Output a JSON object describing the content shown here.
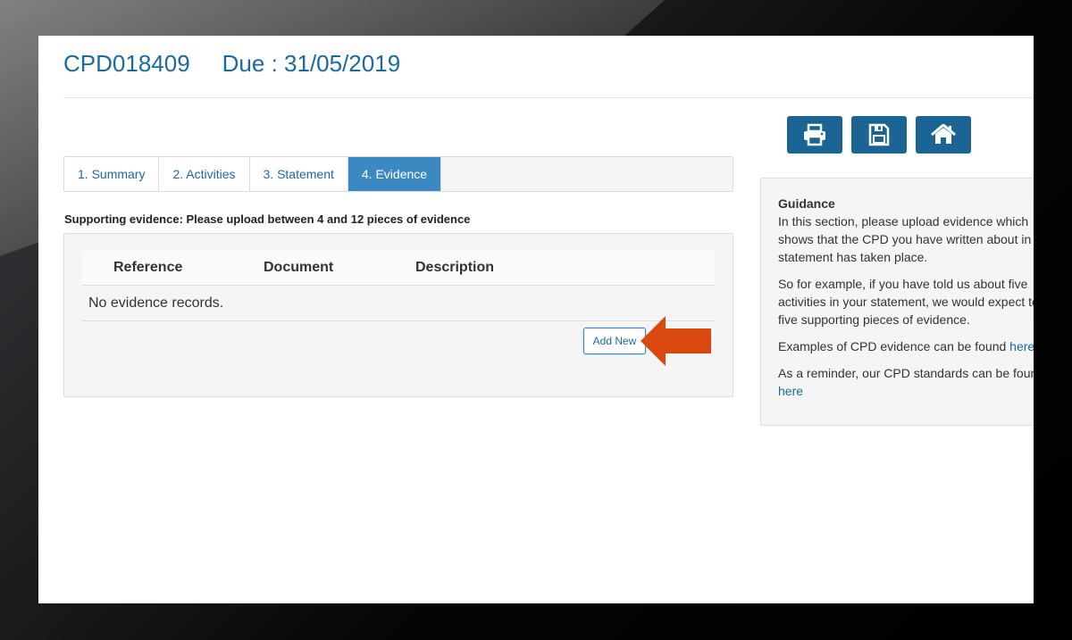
{
  "header": {
    "record_id": "CPD018409",
    "due": "Due : 31/05/2019"
  },
  "toolbar": {
    "icons": [
      "print-icon",
      "save-icon",
      "home-icon"
    ]
  },
  "tabs": [
    {
      "label": "1. Summary",
      "active": false
    },
    {
      "label": "2. Activities",
      "active": false
    },
    {
      "label": "3. Statement",
      "active": false
    },
    {
      "label": "4. Evidence",
      "active": true
    }
  ],
  "evidence": {
    "instruction": "Supporting evidence: Please upload between 4 and 12 pieces of evidence",
    "columns": [
      "Reference",
      "Document",
      "Description"
    ],
    "empty_text": "No evidence records.",
    "add_label": "Add New"
  },
  "guidance": {
    "title": "Guidance",
    "p1": "In this section, please upload evidence which shows that the CPD you have written about in statement has taken place.",
    "p2": "So for example, if you have told us about five activities in your statement, we would expect to five supporting pieces of evidence.",
    "p3": "Examples of CPD evidence can be found",
    "p3_link": "here",
    "p4": "As a reminder, our CPD standards can be foun",
    "p4_link": "here"
  },
  "colors": {
    "primary": "#1a6594",
    "active_tab": "#3b88c3",
    "arrow": "#d9480f"
  }
}
